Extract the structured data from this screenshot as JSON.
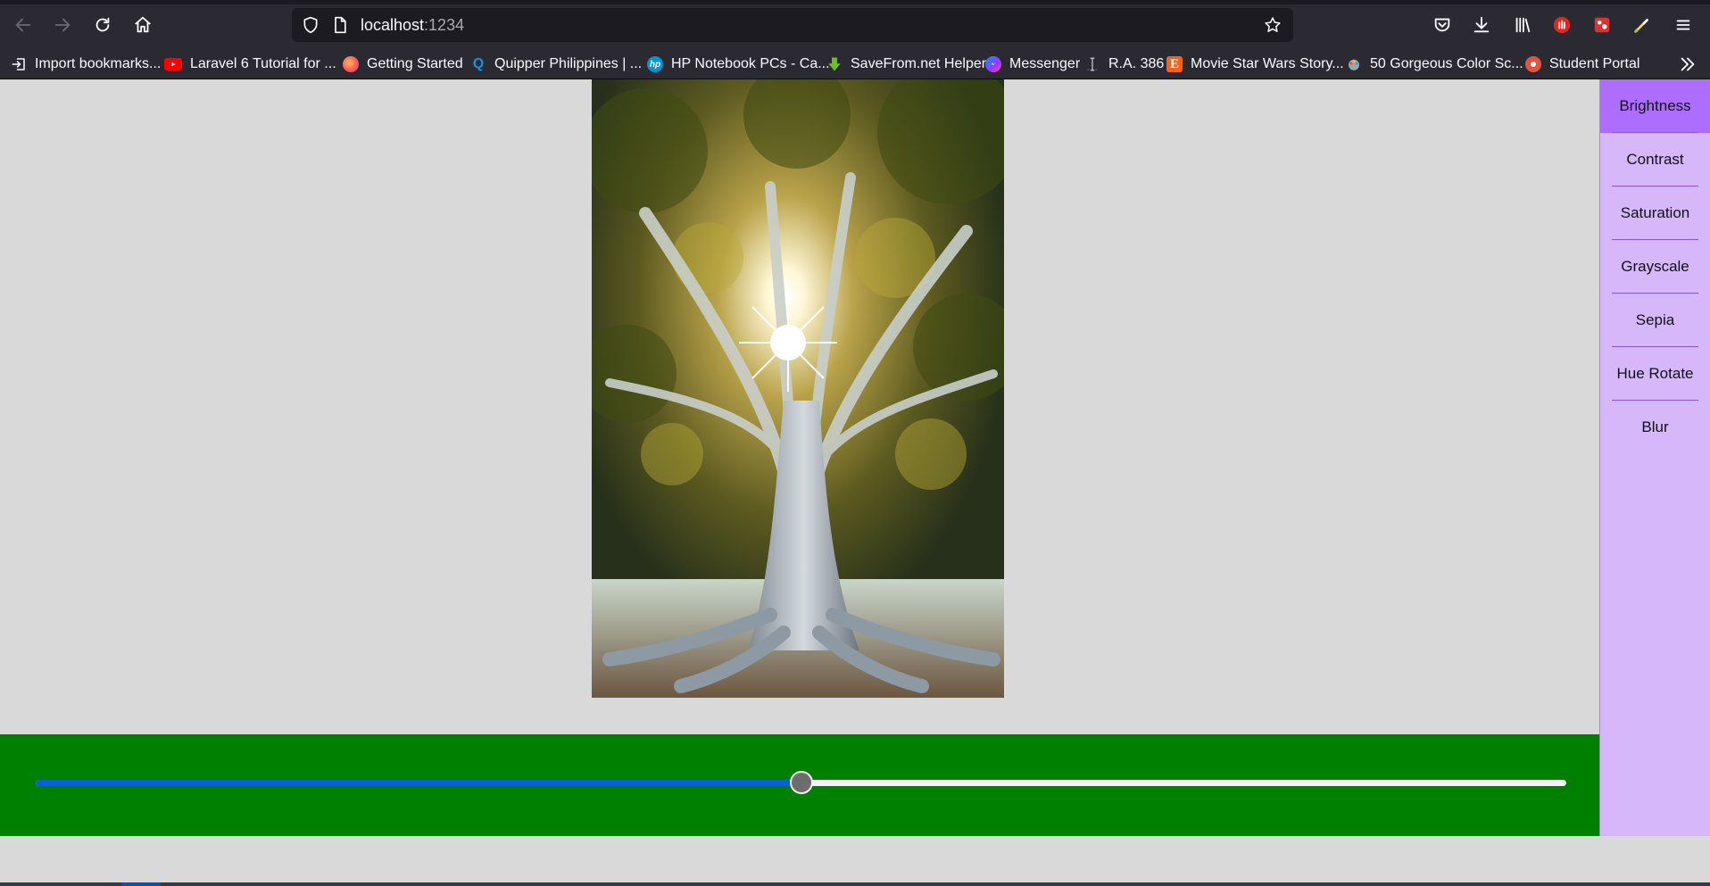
{
  "browser": {
    "url_host": "localhost",
    "url_port": ":1234",
    "bookmarks": [
      {
        "label": "Import bookmarks...",
        "icon": "import-icon",
        "color": "#fbfbfe"
      },
      {
        "label": "Laravel 6 Tutorial for ...",
        "icon": "youtube-icon",
        "color": "#ff0000"
      },
      {
        "label": "Getting Started",
        "icon": "firefox-icon",
        "color": "#ff7139"
      },
      {
        "label": "Quipper Philippines | ...",
        "icon": "quipper-icon",
        "color": "#1a8fe3"
      },
      {
        "label": "HP Notebook PCs - Ca...",
        "icon": "hp-icon",
        "color": "#0096d6"
      },
      {
        "label": "SaveFrom.net Helper",
        "icon": "download-arrow-icon",
        "color": "#6abf2c"
      },
      {
        "label": "Messenger",
        "icon": "messenger-icon",
        "color": "#a033ff"
      },
      {
        "label": "R.A. 386",
        "icon": "text-cursor-icon",
        "color": "#cfcfd8"
      },
      {
        "label": "Movie Star Wars Story...",
        "icon": "etsy-icon",
        "color": "#f1641e"
      },
      {
        "label": "50 Gorgeous Color Sc...",
        "icon": "palette-icon",
        "color": "#9aa7b5"
      },
      {
        "label": "Student Portal",
        "icon": "portal-icon",
        "color": "#e2543f"
      }
    ]
  },
  "filters": {
    "items": [
      "Brightness",
      "Contrast",
      "Saturation",
      "Grayscale",
      "Sepia",
      "Hue Rotate",
      "Blur"
    ],
    "active": "Brightness"
  },
  "slider": {
    "value": 0.5,
    "fill_color": "#0b5fd6",
    "panel_color": "#008000"
  },
  "colors": {
    "sidebar": "#d6b8fa",
    "sidebar_active": "#ad6dff",
    "page_bg": "#d9d9d9"
  }
}
